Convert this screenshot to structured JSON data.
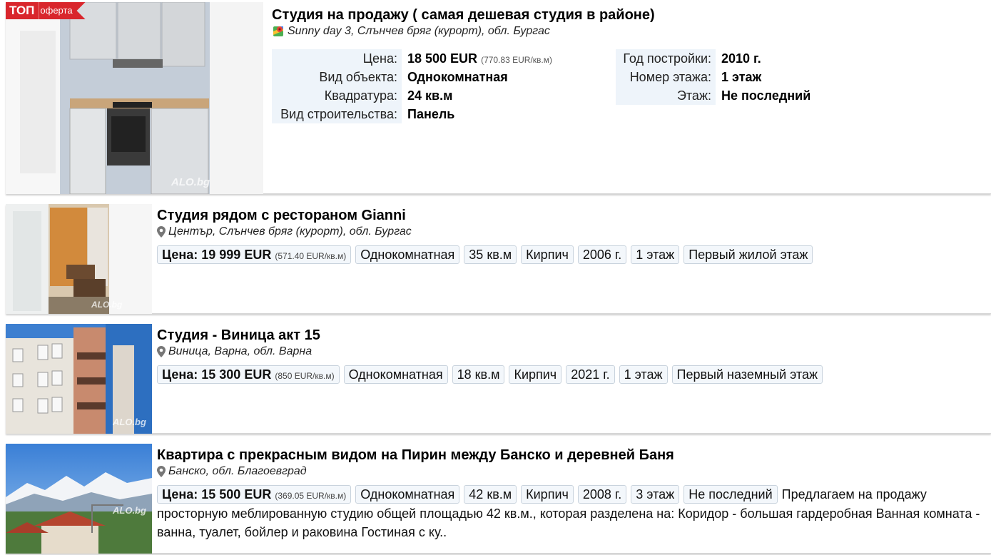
{
  "badge": {
    "top": "ТОП",
    "offer": "оферта"
  },
  "watermark": "ALO.bg",
  "listings": [
    {
      "title": "Студия на продажу ( самая дешевая студия в районе)",
      "location": "Sunny day 3, Слънчев бряг (курорт), обл. Бургас",
      "params_left": [
        {
          "label": "Цена:",
          "value": "18 500 EUR",
          "extra": "(770.83 EUR/кв.м)"
        },
        {
          "label": "Вид объекта:",
          "value": "Однокомнатная"
        },
        {
          "label": "Квадратура:",
          "value": "24 кв.м"
        },
        {
          "label": "Вид строительства:",
          "value": "Панель"
        }
      ],
      "params_right": [
        {
          "label": "Год постройки:",
          "value": "2010 г."
        },
        {
          "label": "Номер этажа:",
          "value": "1 этаж"
        },
        {
          "label": "Этаж:",
          "value": "Не последний"
        }
      ]
    },
    {
      "title": "Студия рядом с рестораном Gianni",
      "location": "Център, Слънчев бряг (курорт), обл. Бургас",
      "price": "Цена: 19 999 EUR",
      "price_per": "(571.40 EUR/кв.м)",
      "tags": [
        "Однокомнатная",
        "35 кв.м",
        "Кирпич",
        "2006 г.",
        "1 этаж",
        "Первый жилой этаж"
      ]
    },
    {
      "title": "Студия - Виница акт 15",
      "location": "Виница, Варна, обл. Варна",
      "price": "Цена: 15 300 EUR",
      "price_per": "(850 EUR/кв.м)",
      "tags": [
        "Однокомнатная",
        "18 кв.м",
        "Кирпич",
        "2021 г.",
        "1 этаж",
        "Первый наземный этаж"
      ]
    },
    {
      "title": "Квартира с прекрасным видом на Пирин между Банско и деревней Баня",
      "location": "Банско, обл. Благоевград",
      "price": "Цена: 15 500 EUR",
      "price_per": "(369.05 EUR/кв.м)",
      "tags": [
        "Однокомнатная",
        "42 кв.м",
        "Кирпич",
        "2008 г.",
        "3 этаж",
        "Не последний"
      ],
      "desc_inline": "Предлагаем на продажу",
      "desc_rest": "просторную меблированную студию общей площадью 42 кв.м., которая разделена на: Коридор - большая гардеробная Ванная комната - ванна, туалет, бойлер и раковина Гостиная с ку.."
    }
  ]
}
